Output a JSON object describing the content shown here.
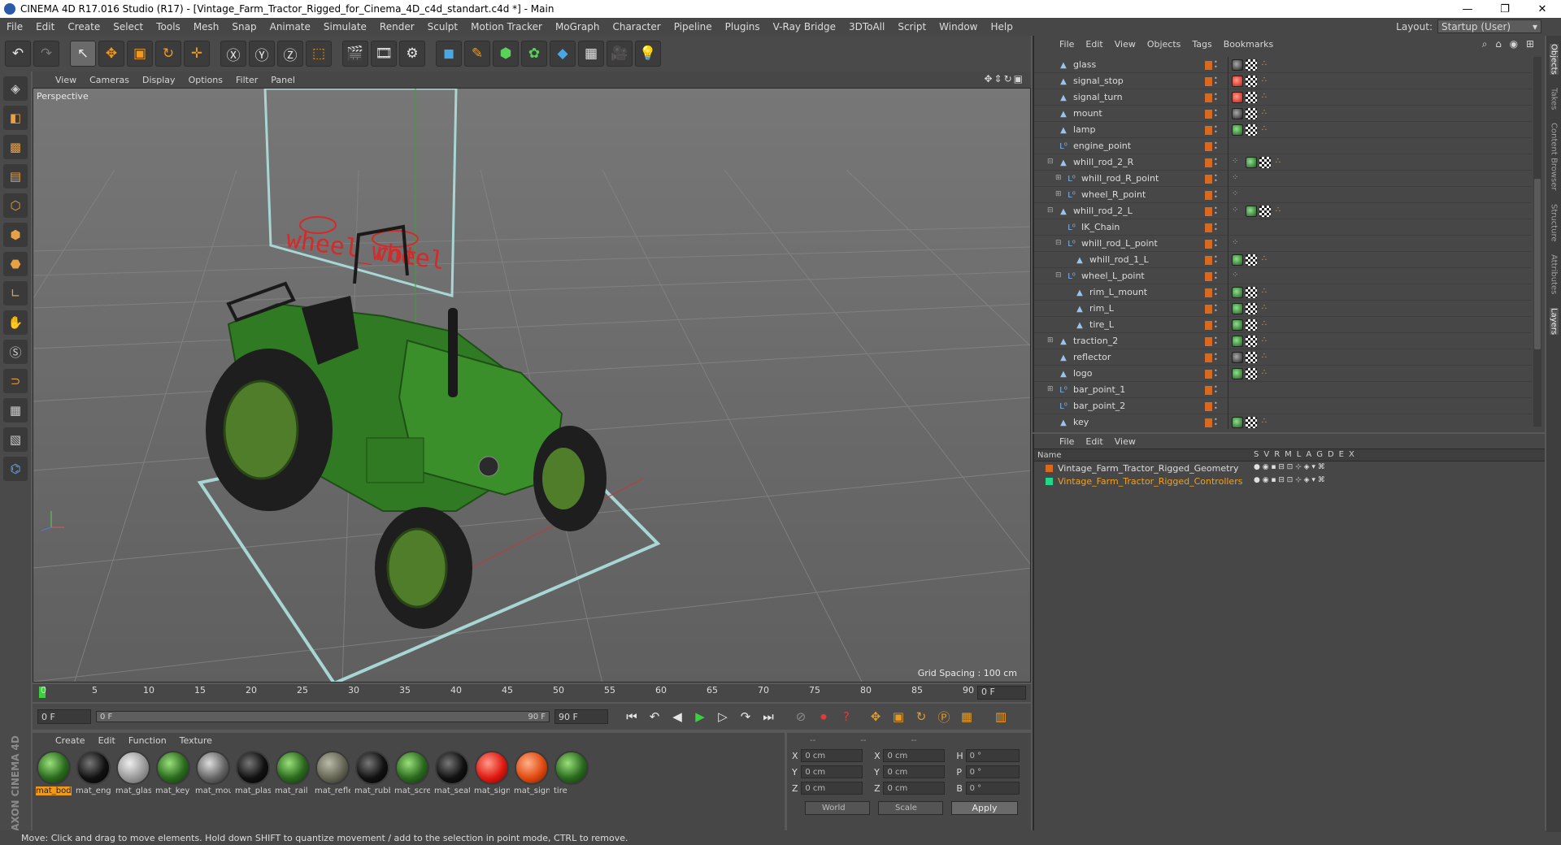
{
  "window": {
    "title": "CINEMA 4D R17.016 Studio (R17) - [Vintage_Farm_Tractor_Rigged_for_Cinema_4D_c4d_standart.c4d *] - Main",
    "minimize": "—",
    "maximize": "❐",
    "close": "✕"
  },
  "menu": [
    "File",
    "Edit",
    "Create",
    "Select",
    "Tools",
    "Mesh",
    "Snap",
    "Animate",
    "Simulate",
    "Render",
    "Sculpt",
    "Motion Tracker",
    "MoGraph",
    "Character",
    "Pipeline",
    "Plugins",
    "V-Ray Bridge",
    "3DToAll",
    "Script",
    "Window",
    "Help"
  ],
  "layout": {
    "label": "Layout:",
    "value": "Startup (User)"
  },
  "viewport": {
    "menu": [
      "View",
      "Cameras",
      "Display",
      "Options",
      "Filter",
      "Panel"
    ],
    "label": "Perspective",
    "grid_spacing": "Grid Spacing : 100 cm",
    "labels3d": [
      "wheel_rot",
      "wheel"
    ]
  },
  "timeline": {
    "ticks": [
      "0",
      "5",
      "10",
      "15",
      "20",
      "25",
      "30",
      "35",
      "40",
      "45",
      "50",
      "55",
      "60",
      "65",
      "70",
      "75",
      "80",
      "85",
      "90"
    ],
    "current": "0 F"
  },
  "transport": {
    "start": "0 F",
    "slider_start": "0 F",
    "slider_end": "90 F",
    "end": "90 F"
  },
  "materials": {
    "menu": [
      "Create",
      "Edit",
      "Function",
      "Texture"
    ],
    "items": [
      {
        "name": "mat_body",
        "kind": "green",
        "selected": true
      },
      {
        "name": "mat_engine",
        "kind": "black"
      },
      {
        "name": "mat_glass",
        "kind": "glass"
      },
      {
        "name": "mat_key",
        "kind": "green"
      },
      {
        "name": "mat_mount",
        "kind": "grey"
      },
      {
        "name": "mat_plastic",
        "kind": "black"
      },
      {
        "name": "mat_rail",
        "kind": "green"
      },
      {
        "name": "mat_reflector",
        "kind": "env"
      },
      {
        "name": "mat_rubber",
        "kind": "black"
      },
      {
        "name": "mat_screw",
        "kind": "green"
      },
      {
        "name": "mat_seat",
        "kind": "black"
      },
      {
        "name": "mat_signal",
        "kind": "red"
      },
      {
        "name": "mat_signal",
        "kind": "orange"
      },
      {
        "name": "tire",
        "kind": "green"
      }
    ]
  },
  "coords": {
    "heads": [
      "--",
      "--",
      "--"
    ],
    "rows": [
      {
        "a": "X",
        "av": "0 cm",
        "b": "X",
        "bv": "0 cm",
        "c": "H",
        "cv": "0 °"
      },
      {
        "a": "Y",
        "av": "0 cm",
        "b": "Y",
        "bv": "0 cm",
        "c": "P",
        "cv": "0 °"
      },
      {
        "a": "Z",
        "av": "0 cm",
        "b": "Z",
        "bv": "0 cm",
        "c": "B",
        "cv": "0 °"
      }
    ],
    "world": "World",
    "scale": "Scale",
    "apply": "Apply"
  },
  "status": "Move: Click and drag to move elements. Hold down SHIFT to quantize movement / add to the selection in point mode, CTRL to remove.",
  "brand": "MAXON CINEMA 4D",
  "objects": {
    "menu": [
      "File",
      "Edit",
      "View",
      "Objects",
      "Tags",
      "Bookmarks"
    ],
    "rows": [
      {
        "name": "glass",
        "indent": 3,
        "type": "poly",
        "tags": [
          "mat-d",
          "chk",
          "oc"
        ]
      },
      {
        "name": "signal_stop",
        "indent": 3,
        "type": "poly",
        "tags": [
          "mat-r",
          "chk",
          "oc"
        ]
      },
      {
        "name": "signal_turn",
        "indent": 3,
        "type": "poly",
        "tags": [
          "mat-r",
          "chk",
          "oc"
        ]
      },
      {
        "name": "mount",
        "indent": 3,
        "type": "poly",
        "tags": [
          "mat-d",
          "chk",
          "oc"
        ]
      },
      {
        "name": "lamp",
        "indent": 3,
        "type": "poly",
        "tags": [
          "mat-g",
          "chk",
          "oc"
        ]
      },
      {
        "name": "engine_point",
        "indent": 3,
        "type": "null",
        "tags": []
      },
      {
        "name": "whill_rod_2_R",
        "indent": 3,
        "type": "poly",
        "tree": "⊟",
        "tags": [
          "ik",
          "mat-g",
          "chk",
          "oc"
        ]
      },
      {
        "name": "whill_rod_R_point",
        "indent": 4,
        "type": "null",
        "tree": "⊞",
        "tags": [
          "ik"
        ]
      },
      {
        "name": "wheel_R_point",
        "indent": 4,
        "type": "null",
        "tree": "⊞",
        "tags": [
          "ik"
        ]
      },
      {
        "name": "whill_rod_2_L",
        "indent": 3,
        "type": "poly",
        "tree": "⊟",
        "tags": [
          "ik",
          "mat-g",
          "chk",
          "oc"
        ]
      },
      {
        "name": "IK_Chain",
        "indent": 4,
        "type": "null",
        "tags": []
      },
      {
        "name": "whill_rod_L_point",
        "indent": 4,
        "type": "null",
        "tree": "⊟",
        "tags": [
          "ik"
        ]
      },
      {
        "name": "whill_rod_1_L",
        "indent": 5,
        "type": "poly",
        "tags": [
          "mat-g",
          "chk",
          "oc"
        ]
      },
      {
        "name": "wheel_L_point",
        "indent": 4,
        "type": "null",
        "tree": "⊟",
        "tags": [
          "ik"
        ]
      },
      {
        "name": "rim_L_mount",
        "indent": 5,
        "type": "poly",
        "tags": [
          "mat-g",
          "chk",
          "oc"
        ]
      },
      {
        "name": "rim_L",
        "indent": 5,
        "type": "poly",
        "tags": [
          "mat-g",
          "chk",
          "oc"
        ]
      },
      {
        "name": "tire_L",
        "indent": 5,
        "type": "poly",
        "tags": [
          "mat-g",
          "chk",
          "oc"
        ]
      },
      {
        "name": "traction_2",
        "indent": 3,
        "type": "poly",
        "tree": "⊞",
        "tags": [
          "mat-g",
          "chk",
          "oc"
        ]
      },
      {
        "name": "reflector",
        "indent": 3,
        "type": "poly",
        "tags": [
          "mat-d",
          "chk",
          "oc"
        ]
      },
      {
        "name": "logo",
        "indent": 3,
        "type": "poly",
        "tags": [
          "mat-g",
          "chk",
          "oc"
        ]
      },
      {
        "name": "bar_point_1",
        "indent": 3,
        "type": "null",
        "tree": "⊞",
        "tags": []
      },
      {
        "name": "bar_point_2",
        "indent": 3,
        "type": "null",
        "tags": []
      },
      {
        "name": "key",
        "indent": 3,
        "type": "poly",
        "tags": [
          "mat-g",
          "chk",
          "oc"
        ]
      }
    ]
  },
  "layers": {
    "menu": [
      "File",
      "Edit",
      "View"
    ],
    "header": "Name",
    "flags": [
      "S",
      "V",
      "R",
      "M",
      "L",
      "A",
      "G",
      "D",
      "E",
      "X"
    ],
    "rows": [
      {
        "name": "Vintage_Farm_Tractor_Rigged_Geometry",
        "color": "#d86a1f"
      },
      {
        "name": "Vintage_Farm_Tractor_Rigged_Controllers",
        "color": "#1fd88a"
      }
    ]
  },
  "right_tabs": [
    "Objects",
    "Takes",
    "Content Browser",
    "Structure",
    "Attributes",
    "Layers"
  ]
}
